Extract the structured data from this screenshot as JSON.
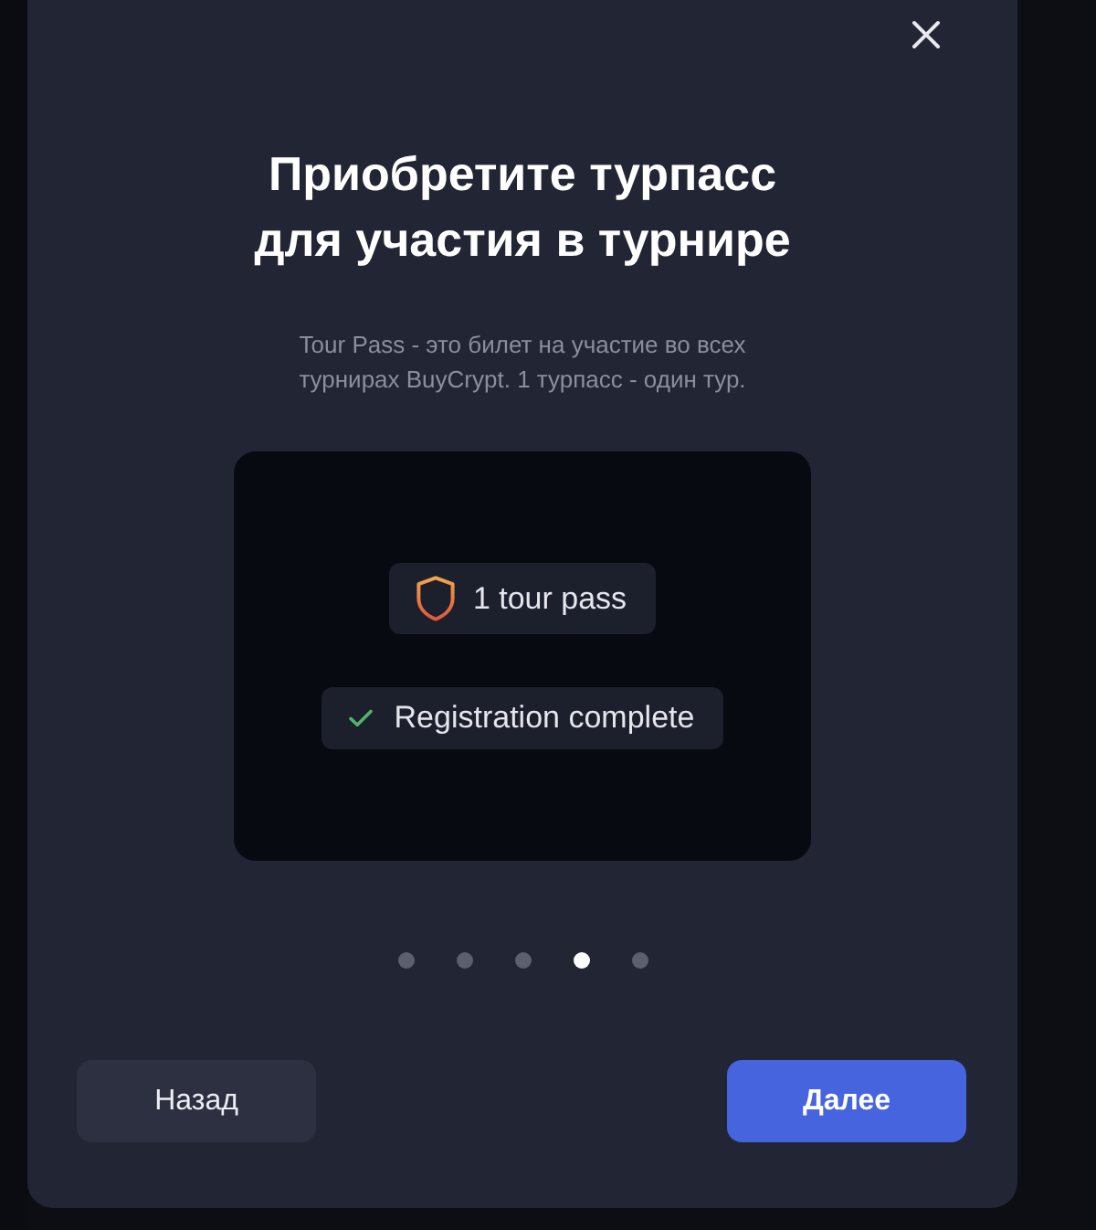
{
  "dialog": {
    "title": "Приобретите турпасс для участия в турнире",
    "subtitle": "Tour Pass - это билет на участие во всех турнирах BuyCrypt. 1 турпасс - один тур.",
    "preview": {
      "badges": [
        {
          "kind": "pass",
          "label": "1 tour pass"
        },
        {
          "kind": "check",
          "label": "Registration complete"
        }
      ]
    },
    "steps": [
      {
        "selected": false
      },
      {
        "selected": false
      },
      {
        "selected": false
      },
      {
        "selected": true
      },
      {
        "selected": false
      }
    ],
    "buttons": [
      {
        "kind": "secondary",
        "label": "Назад"
      },
      {
        "kind": "primary",
        "label": "Далее"
      }
    ]
  }
}
